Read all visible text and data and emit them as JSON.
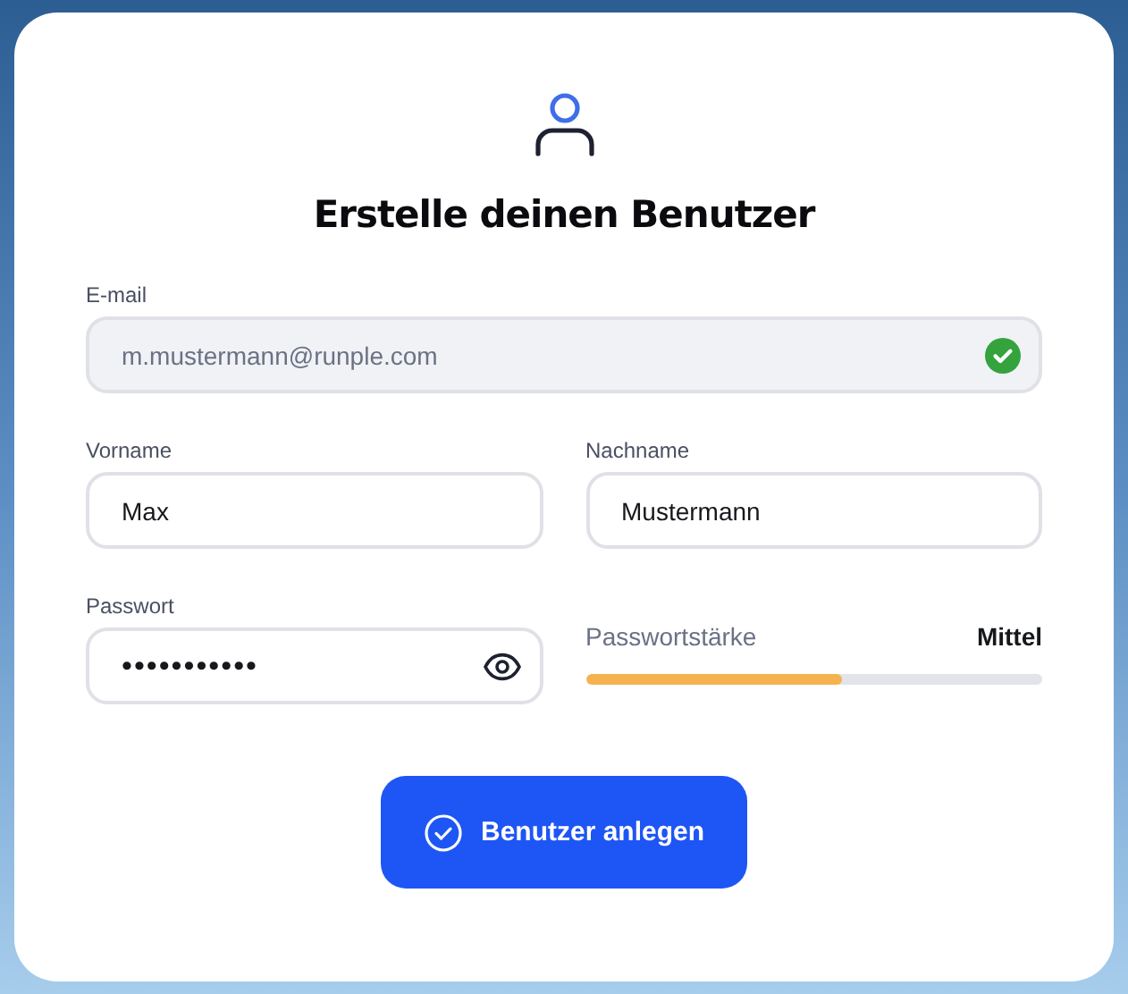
{
  "title": "Erstelle deinen Benutzer",
  "email": {
    "label": "E-mail",
    "value": "m.mustermann@runple.com",
    "disabled": true,
    "valid": true
  },
  "first_name": {
    "label": "Vorname",
    "value": "Max"
  },
  "last_name": {
    "label": "Nachname",
    "value": "Mustermann"
  },
  "password": {
    "label": "Passwort",
    "value": "•••••••••••"
  },
  "password_strength": {
    "label": "Passwortstärke",
    "reading": "Mittel",
    "level": 0.56
  },
  "submit_button": {
    "label": "Benutzer anlegen"
  }
}
